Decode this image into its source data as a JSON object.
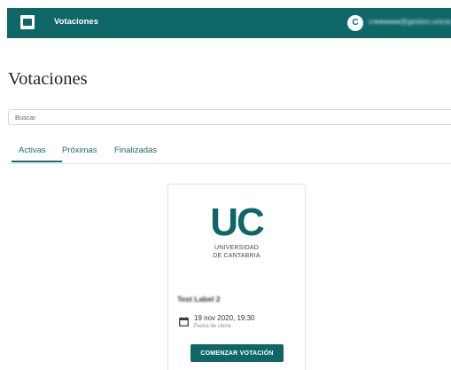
{
  "header": {
    "app_title": "Votaciones",
    "avatar_initial": "C",
    "user_email": "cr●●●●●●@gestion.unican.es"
  },
  "page": {
    "title": "Votaciones"
  },
  "search": {
    "placeholder": "Buscar",
    "value": ""
  },
  "tabs": [
    {
      "label": "Activas",
      "active": true
    },
    {
      "label": "Próximas",
      "active": false
    },
    {
      "label": "Finalizadas",
      "active": false
    }
  ],
  "card": {
    "logo_text": "UC",
    "university_line1": "UNIVERSIDAD",
    "university_line2": "DE CANTABRIA",
    "vote_title": "Test Label 2",
    "close_date": "19 nov 2020, 19:30",
    "close_date_label": "Fecha de cierre",
    "button_label": "COMENZAR VOTACIÓN"
  },
  "colors": {
    "brand": "#0f6666",
    "tab_text": "#1d6a6a"
  }
}
